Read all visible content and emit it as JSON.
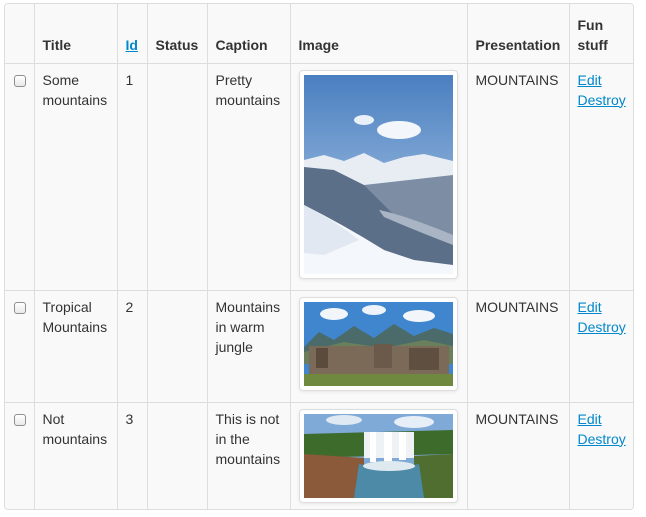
{
  "headers": {
    "title": "Title",
    "id": "Id",
    "status": "Status",
    "caption": "Caption",
    "image": "Image",
    "presentation": "Presentation",
    "fun_line1": "Fun",
    "fun_line2": "stuff"
  },
  "rows": [
    {
      "title_l1": "Some",
      "title_l2": "mountains",
      "id": "1",
      "status": "",
      "caption_l1": "Pretty",
      "caption_l2": "mountains",
      "caption_l3": "",
      "presentation": "MOUNTAINS",
      "edit": "Edit",
      "destroy": "Destroy"
    },
    {
      "title_l1": "Tropical",
      "title_l2": "Mountains",
      "id": "2",
      "status": "",
      "caption_l1": "Mountains",
      "caption_l2": "in warm",
      "caption_l3": "jungle",
      "presentation": "MOUNTAINS",
      "edit": "Edit",
      "destroy": "Destroy"
    },
    {
      "title_l1": "Not",
      "title_l2": "mountains",
      "id": "3",
      "status": "",
      "caption_l1": "This is not",
      "caption_l2": "in the",
      "caption_l3": "mountains",
      "presentation": "MOUNTAINS",
      "edit": "Edit",
      "destroy": "Destroy"
    }
  ],
  "colors": {
    "link": "#0088cc",
    "border": "#dddddd",
    "row_bg": "#f9f9f9"
  }
}
